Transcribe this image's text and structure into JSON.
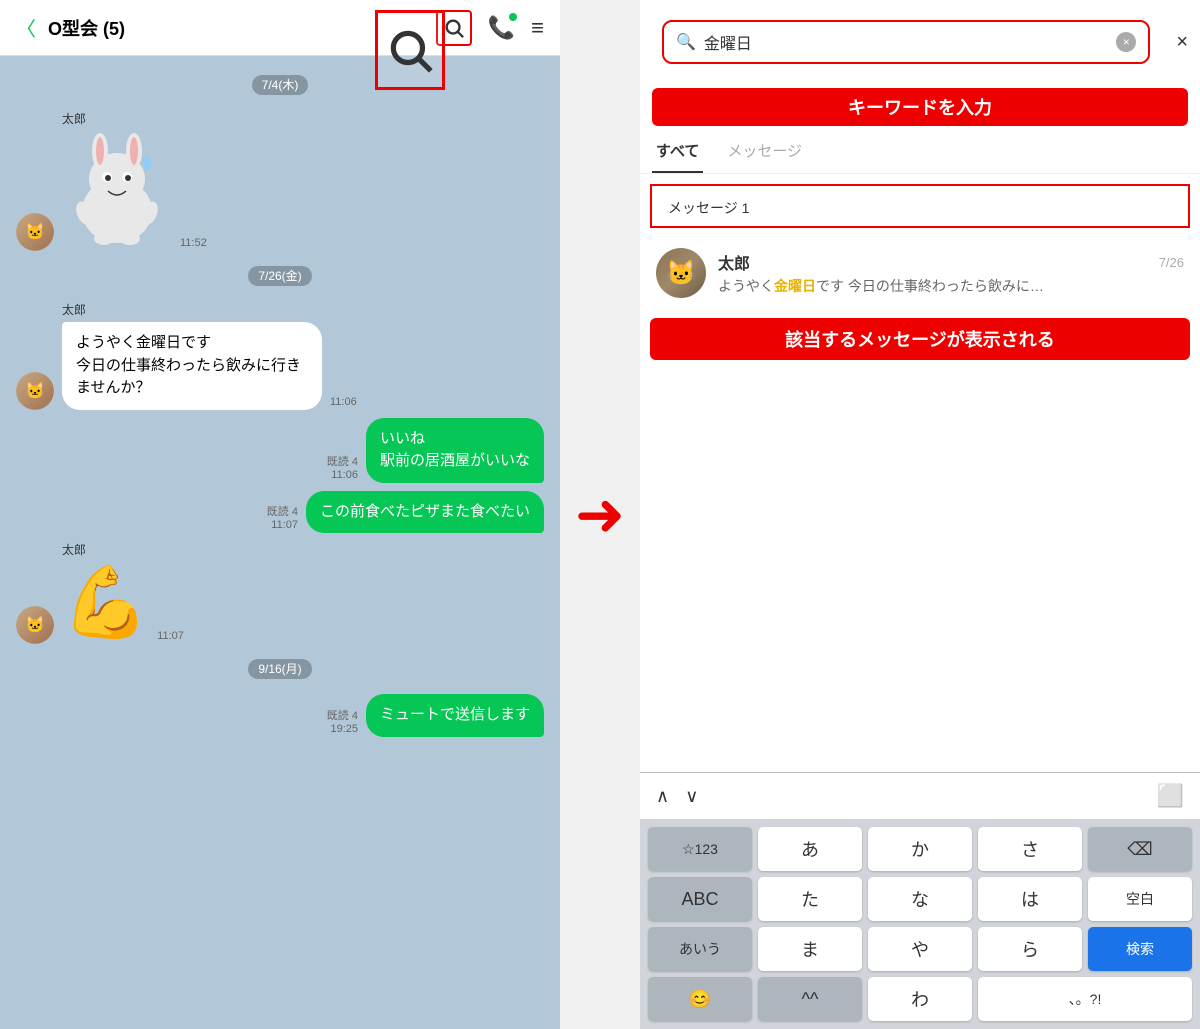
{
  "left": {
    "header": {
      "back_label": "〈",
      "title": "O型会 (5)",
      "phone_icon": "📞",
      "menu_icon": "≡"
    },
    "messages": [
      {
        "type": "date",
        "text": "7/4(木)"
      },
      {
        "type": "sticker",
        "sender": "太郎",
        "time": "11:52"
      },
      {
        "type": "date",
        "text": "7/26(金)"
      },
      {
        "type": "received",
        "sender": "太郎",
        "text": "ようやく金曜日です\n今日の仕事終わったら飲みに行きませんか？",
        "time": "11:06"
      },
      {
        "type": "sent",
        "text": "いいね\n駅前の居酒屋がいいな",
        "meta_read": "既読 4",
        "time": "11:06"
      },
      {
        "type": "sent",
        "text": "この前食べたピザまた食べたい",
        "meta_read": "既読 4",
        "time": "11:07"
      },
      {
        "type": "flex_sticker",
        "sender": "太郎",
        "time": "11:07"
      },
      {
        "type": "date",
        "text": "9/16(月)"
      },
      {
        "type": "sent_muted",
        "text": "ミュートで送信します",
        "meta_read": "既読 4",
        "time": "19:25"
      }
    ]
  },
  "arrow": "→",
  "right": {
    "search": {
      "placeholder": "金曜日",
      "keyword_label": "キーワードを入力",
      "clear_icon": "×",
      "close_icon": "×"
    },
    "tabs": [
      {
        "label": "すべて",
        "active": true
      },
      {
        "label": "メッセージ",
        "active": false
      }
    ],
    "result_section_title": "メッセージ 1",
    "result_item": {
      "name": "太郎",
      "date": "7/26",
      "preview_before": "ようやく",
      "preview_highlight": "金曜日",
      "preview_after": "です 今日の仕事終わったら飲みに…"
    },
    "message_annotation": "該当するメッセージが表示される",
    "keyboard": {
      "nav_up": "∧",
      "nav_down": "∨",
      "calendar": "□",
      "keys": [
        {
          "label": "☆123",
          "style": "gray small"
        },
        {
          "label": "あ",
          "style": "white"
        },
        {
          "label": "か",
          "style": "white"
        },
        {
          "label": "さ",
          "style": "white"
        },
        {
          "label": "⌫",
          "style": "gray"
        },
        {
          "label": "ABC",
          "style": "gray"
        },
        {
          "label": "た",
          "style": "white"
        },
        {
          "label": "な",
          "style": "white"
        },
        {
          "label": "は",
          "style": "white"
        },
        {
          "label": "空白",
          "style": "white small"
        },
        {
          "label": "あいう",
          "style": "gray small"
        },
        {
          "label": "ま",
          "style": "white"
        },
        {
          "label": "や",
          "style": "white"
        },
        {
          "label": "ら",
          "style": "white"
        },
        {
          "label": "検索",
          "style": "blue small"
        },
        {
          "label": "😊",
          "style": "gray"
        },
        {
          "label": "^^",
          "style": "gray"
        },
        {
          "label": "わ",
          "style": "white"
        },
        {
          "label": "、。?!",
          "style": "white small"
        }
      ]
    }
  }
}
